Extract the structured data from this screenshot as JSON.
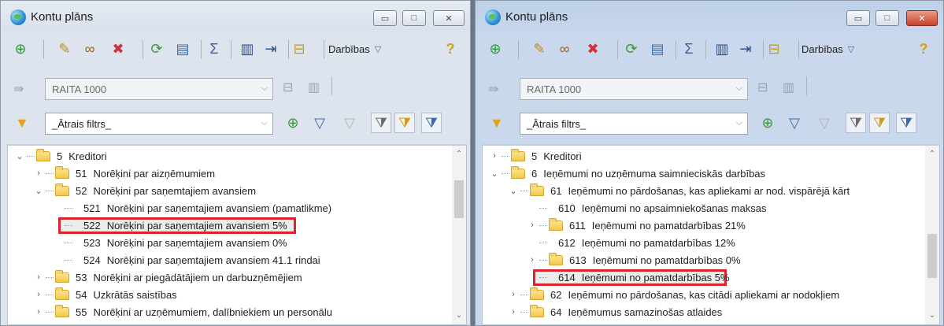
{
  "windows": [
    {
      "title": "Kontu plāns",
      "menu_label": "Darbības",
      "company_value": "RAITA 1000",
      "filter_value": "_Ātrais filtrs_",
      "tree": [
        {
          "code": "5",
          "label": "Kreditori",
          "level": 0,
          "expander": "open",
          "folder": true
        },
        {
          "code": "51",
          "label": "Norēķini par aizņēmumiem",
          "level": 1,
          "expander": "closed",
          "folder": true
        },
        {
          "code": "52",
          "label": "Norēķini par saņemtajiem avansiem",
          "level": 1,
          "expander": "open",
          "folder": true
        },
        {
          "code": "521",
          "label": "Norēķini par saņemtajiem avansiem (pamatlikme)",
          "level": 2,
          "expander": "none",
          "folder": false
        },
        {
          "code": "522",
          "label": "Norēķini par saņemtajiem avansiem 5%",
          "level": 2,
          "expander": "none",
          "folder": false,
          "highlighted": true
        },
        {
          "code": "523",
          "label": "Norēķini par saņemtajiem avansiem 0%",
          "level": 2,
          "expander": "none",
          "folder": false
        },
        {
          "code": "524",
          "label": "Norēķini par saņemtajiem avansiem 41.1 rindai",
          "level": 2,
          "expander": "none",
          "folder": false
        },
        {
          "code": "53",
          "label": "Norēķini ar piegādātājiem un darbuzņēmējiem",
          "level": 1,
          "expander": "closed",
          "folder": true
        },
        {
          "code": "54",
          "label": "Uzkrātās saistības",
          "level": 1,
          "expander": "closed",
          "folder": true
        },
        {
          "code": "55",
          "label": "Norēķini ar uzņēmumiem, dalībniekiem un personālu",
          "level": 1,
          "expander": "closed",
          "folder": true
        }
      ]
    },
    {
      "title": "Kontu plāns",
      "menu_label": "Darbības",
      "company_value": "RAITA 1000",
      "filter_value": "_Ātrais filtrs_",
      "tree": [
        {
          "code": "5",
          "label": "Kreditori",
          "level": 0,
          "expander": "closed",
          "folder": true
        },
        {
          "code": "6",
          "label": "Ieņēmumi no uzņēmuma saimnieciskās darbības",
          "level": 0,
          "expander": "open",
          "folder": true
        },
        {
          "code": "61",
          "label": "Ieņēmumi no pārdošanas, kas apliekami ar nod. vispārējā kārt",
          "level": 1,
          "expander": "open",
          "folder": true
        },
        {
          "code": "610",
          "label": "Ieņēmumi no apsaimniekošanas maksas",
          "level": 2,
          "expander": "none",
          "folder": false
        },
        {
          "code": "611",
          "label": "Ieņēmumi no pamatdarbības 21%",
          "level": 2,
          "expander": "closed",
          "folder": true
        },
        {
          "code": "612",
          "label": "Ieņēmumi no pamatdarbības 12%",
          "level": 2,
          "expander": "none",
          "folder": false
        },
        {
          "code": "613",
          "label": "Ieņēmumi no pamatdarbības 0%",
          "level": 2,
          "expander": "closed",
          "folder": true
        },
        {
          "code": "614",
          "label": "Ieņēmumi no pamatdarbības 5%",
          "level": 2,
          "expander": "none",
          "folder": false,
          "highlighted": true
        },
        {
          "code": "62",
          "label": "Ieņēmumi no pārdošanas, kas citādi apliekami ar nodokļiem",
          "level": 1,
          "expander": "closed",
          "folder": true
        },
        {
          "code": "64",
          "label": "Ieņēmumus samazinošas atlaides",
          "level": 1,
          "expander": "closed",
          "folder": true
        }
      ]
    }
  ],
  "colors": {
    "highlight_border": "#d9242c",
    "close_button": "#c8432a"
  },
  "icons": {
    "toolbar": [
      "add-icon",
      "edit-icon",
      "binoculars-icon",
      "delete-icon",
      "refresh-icon",
      "print-icon",
      "sum-icon",
      "columns-icon",
      "indent-icon",
      "tree-view-icon"
    ],
    "help": "help-icon",
    "filter": [
      "filter-funnel-icon",
      "add-filter-icon",
      "filter-icon",
      "clear-filter-icon",
      "filter-mode-1-icon",
      "filter-mode-2-icon",
      "filter-mode-3-icon"
    ]
  }
}
